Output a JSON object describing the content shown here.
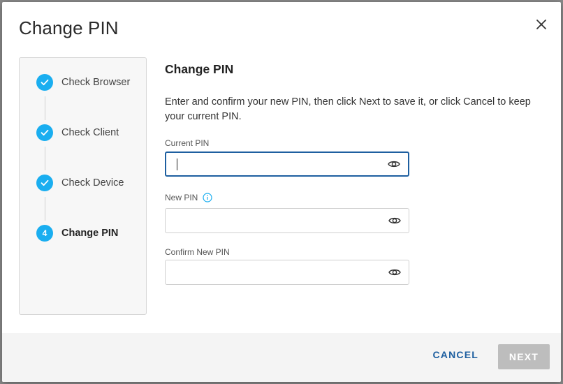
{
  "dialog": {
    "title": "Change PIN",
    "close_icon": "close-icon"
  },
  "stepper": {
    "steps": [
      {
        "label": "Check Browser",
        "status": "done",
        "icon": "check-icon"
      },
      {
        "label": "Check Client",
        "status": "done",
        "icon": "check-icon"
      },
      {
        "label": "Check Device",
        "status": "done",
        "icon": "check-icon"
      },
      {
        "label": "Change PIN",
        "status": "active",
        "number": "4"
      }
    ],
    "accent_color": "#1aaef0"
  },
  "content": {
    "title": "Change PIN",
    "description": "Enter and confirm your new PIN, then click Next to save it, or click Cancel to keep your current PIN.",
    "fields": {
      "current": {
        "label": "Current PIN",
        "value": "",
        "icon": "eye-icon"
      },
      "new": {
        "label": "New PIN",
        "value": "",
        "icon": "eye-icon",
        "info_icon": "info-icon"
      },
      "confirm": {
        "label": "Confirm New PIN",
        "value": "",
        "icon": "eye-icon"
      }
    }
  },
  "footer": {
    "cancel_label": "CANCEL",
    "next_label": "NEXT",
    "link_color": "#1e5fa0"
  }
}
